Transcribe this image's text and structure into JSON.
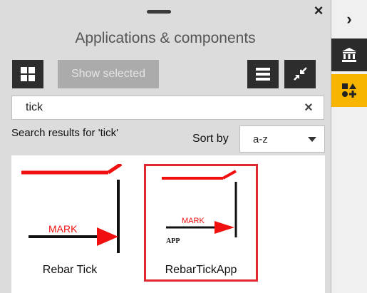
{
  "panel": {
    "title": "Applications & components",
    "close_label": "×"
  },
  "toolbar": {
    "show_selected_label": "Show selected"
  },
  "search": {
    "value": "tick",
    "clear_label": "×"
  },
  "results": {
    "label": "Search results for 'tick'",
    "sort_label": "Sort by",
    "sort_value": "a-z"
  },
  "items": [
    {
      "name": "Rebar Tick",
      "mark_text": "MARK",
      "selected": false
    },
    {
      "name": "RebarTickApp",
      "mark_text": "MARK",
      "sub_text": "APP",
      "selected": true
    }
  ],
  "side_rail": {
    "chevron": "›"
  },
  "colors": {
    "accent": "#f7b500",
    "selection": "#e0282f",
    "dark_button": "#2d2d2d"
  },
  "icons": [
    "drag-handle-icon",
    "close-icon",
    "grid-icon",
    "list-icon",
    "collapse-icon",
    "clear-search-icon",
    "chevron-down-icon",
    "chevron-right-icon",
    "museum-icon",
    "components-icon"
  ]
}
